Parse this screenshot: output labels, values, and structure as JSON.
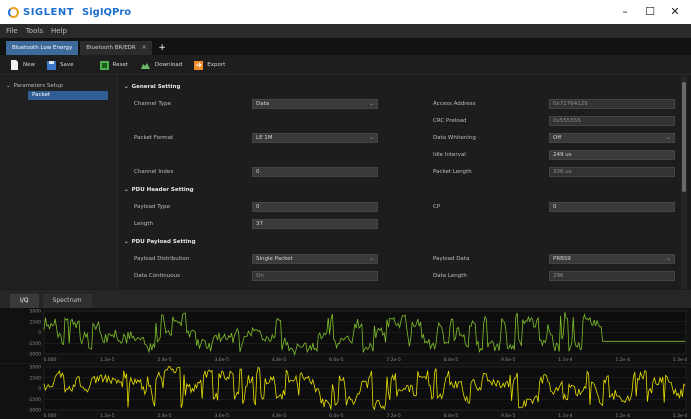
{
  "window": {
    "brand": "SIGLENT",
    "app_title": "SigIQPro",
    "minimize": "–",
    "maximize": "☐",
    "close": "✕"
  },
  "menu": [
    "File",
    "Tools",
    "Help"
  ],
  "doc_tabs": [
    {
      "label": "Bluetooth Low Energy",
      "active": true
    },
    {
      "label": "Bluetooth BR/EDR",
      "active": false
    }
  ],
  "tab_add": "+",
  "toolbar": {
    "new": "New",
    "save": "Save",
    "reset": "Reset",
    "download": "Download",
    "export": "Export"
  },
  "tree": {
    "root": "Parameters Setup",
    "child": "Packet"
  },
  "general_setting": {
    "title": "General Setting",
    "channel_type_label": "Channel Type",
    "channel_type_value": "Data",
    "packet_format_label": "Packet Format",
    "packet_format_value": "LE 1M",
    "channel_index_label": "Channel Index",
    "channel_index_value": "0",
    "access_address_label": "Access Address",
    "access_address_value": "0x71764129",
    "crc_preload_label": "CRC Preload",
    "crc_preload_value": "0x555555",
    "data_whitening_label": "Data Whitening",
    "data_whitening_value": "Off",
    "idle_interval_label": "Idle Interval",
    "idle_interval_value": "249 us",
    "packet_length_label": "Packet Length",
    "packet_length_value": "336 us"
  },
  "pdu_header": {
    "title": "PDU Header Setting",
    "payload_type_label": "Payload Type",
    "payload_type_value": "0",
    "length_label": "Length",
    "length_value": "37",
    "cp_label": "CP",
    "cp_value": "0"
  },
  "pdu_payload": {
    "title": "PDU Payload Setting",
    "distribution_label": "Payload Distribution",
    "distribution_value": "Single Packet",
    "continuous_label": "Data Continuous",
    "continuous_value": "On",
    "payload_data_label": "Payload Data",
    "payload_data_value": "PRBS9",
    "data_length_label": "Data Length",
    "data_length_value": "296"
  },
  "lower_tabs": [
    "I/Q",
    "Spectrum"
  ],
  "plot_i": {
    "color": "#7fbf2a",
    "y_ticks": [
      "5000",
      "2500",
      "0",
      "-2500",
      "-5000"
    ],
    "x_ticks": [
      "0.000",
      "1.2e-5",
      "2.4e-5",
      "3.6e-5",
      "4.8e-5",
      "6.0e-5",
      "7.2e-5",
      "8.4e-5",
      "9.6e-5",
      "1.1e-4",
      "1.2e-4",
      "1.3e-4"
    ]
  },
  "plot_q": {
    "color": "#e8e000",
    "y_ticks": [
      "5000",
      "2500",
      "0",
      "-2500",
      "-5000"
    ],
    "x_ticks": [
      "0.000",
      "1.2e-5",
      "2.4e-5",
      "3.6e-5",
      "4.8e-5",
      "6.0e-5",
      "7.2e-5",
      "8.4e-5",
      "9.6e-5",
      "1.1e-4",
      "1.2e-4",
      "1.3e-4"
    ]
  }
}
